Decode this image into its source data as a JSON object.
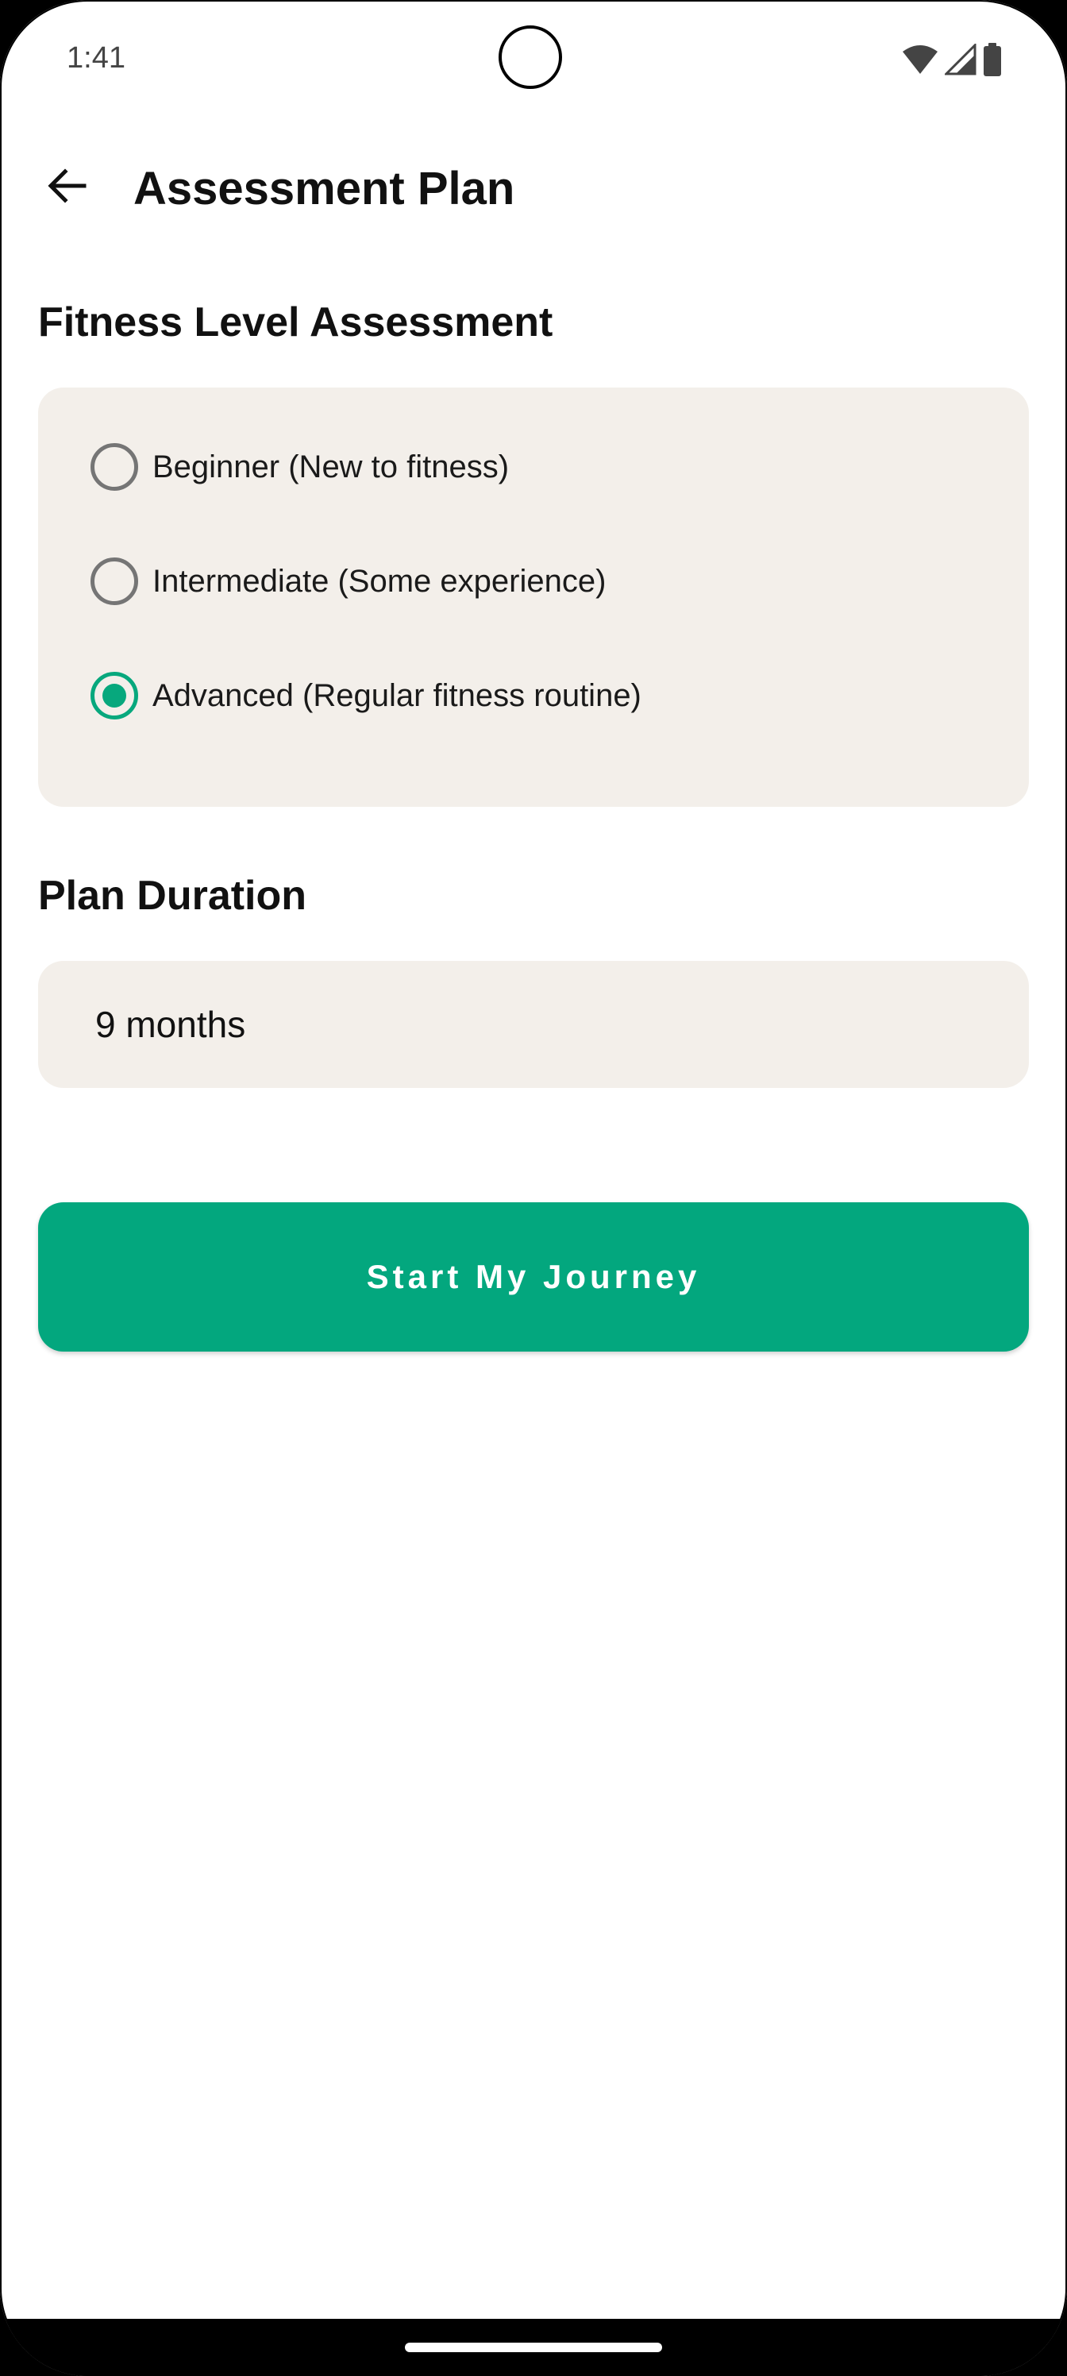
{
  "status_bar": {
    "time": "1:41",
    "icons": [
      "wifi-icon",
      "cellular-signal-icon",
      "battery-icon"
    ]
  },
  "app_bar": {
    "back_icon": "arrow-back-icon",
    "title": "Assessment Plan"
  },
  "fitness_level": {
    "section_title": "Fitness Level Assessment",
    "options": [
      {
        "label": "Beginner (New to fitness)",
        "selected": false
      },
      {
        "label": "Intermediate (Some experience)",
        "selected": false
      },
      {
        "label": "Advanced (Regular fitness routine)",
        "selected": true
      }
    ]
  },
  "plan_duration": {
    "section_title": "Plan Duration",
    "value": "9 months"
  },
  "primary_action": {
    "label": "Start My Journey"
  },
  "colors": {
    "accent": "#03a77e",
    "card_background": "#f3efea",
    "radio_unselected": "#757575"
  }
}
